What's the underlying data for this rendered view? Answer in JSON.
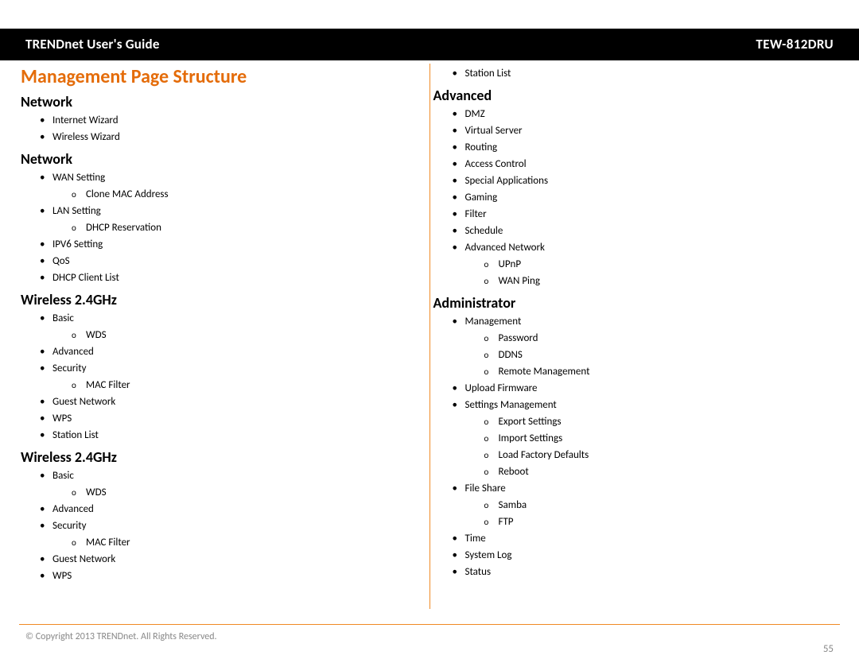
{
  "header": {
    "guide_title": "TRENDnet User's Guide",
    "model": "TEW-812DRU"
  },
  "main_title": "Management Page Structure",
  "left": {
    "sections": [
      {
        "title": "Network",
        "items": [
          {
            "label": "Internet Wizard"
          },
          {
            "label": "Wireless Wizard"
          }
        ]
      },
      {
        "title": "Network",
        "items": [
          {
            "label": "WAN Setting",
            "sub": [
              "Clone MAC Address"
            ]
          },
          {
            "label": "LAN Setting",
            "sub": [
              "DHCP Reservation"
            ]
          },
          {
            "label": "IPV6 Setting"
          },
          {
            "label": "QoS"
          },
          {
            "label": "DHCP Client List"
          }
        ]
      },
      {
        "title": "Wireless 2.4GHz",
        "items": [
          {
            "label": "Basic",
            "sub": [
              "WDS"
            ]
          },
          {
            "label": "Advanced"
          },
          {
            "label": "Security",
            "sub": [
              "MAC Filter"
            ]
          },
          {
            "label": "Guest Network"
          },
          {
            "label": "WPS"
          },
          {
            "label": "Station List"
          }
        ]
      },
      {
        "title": "Wireless 2.4GHz",
        "items": [
          {
            "label": "Basic",
            "sub": [
              "WDS"
            ]
          },
          {
            "label": "Advanced"
          },
          {
            "label": "Security",
            "sub": [
              "MAC Filter"
            ]
          },
          {
            "label": "Guest Network"
          },
          {
            "label": "WPS"
          }
        ]
      }
    ]
  },
  "right": {
    "orphan_items": [
      {
        "label": "Station List"
      }
    ],
    "sections": [
      {
        "title": "Advanced",
        "items": [
          {
            "label": "DMZ"
          },
          {
            "label": "Virtual Server"
          },
          {
            "label": "Routing"
          },
          {
            "label": "Access Control"
          },
          {
            "label": "Special Applications"
          },
          {
            "label": "Gaming"
          },
          {
            "label": "Filter"
          },
          {
            "label": "Schedule"
          },
          {
            "label": "Advanced Network",
            "sub": [
              "UPnP",
              "WAN Ping"
            ]
          }
        ]
      },
      {
        "title": "Administrator",
        "items": [
          {
            "label": "Management",
            "sub": [
              "Password",
              "DDNS",
              "Remote Management"
            ]
          },
          {
            "label": "Upload Firmware"
          },
          {
            "label": "Settings Management",
            "sub": [
              "Export Settings",
              "Import Settings",
              "Load Factory Defaults",
              "Reboot"
            ]
          },
          {
            "label": "File Share",
            "sub": [
              "Samba",
              "FTP"
            ]
          },
          {
            "label": "Time"
          },
          {
            "label": "System Log"
          },
          {
            "label": "Status"
          }
        ]
      }
    ]
  },
  "footer": {
    "copyright": "© Copyright 2013 TRENDnet. All Rights Reserved.",
    "page_number": "55"
  }
}
